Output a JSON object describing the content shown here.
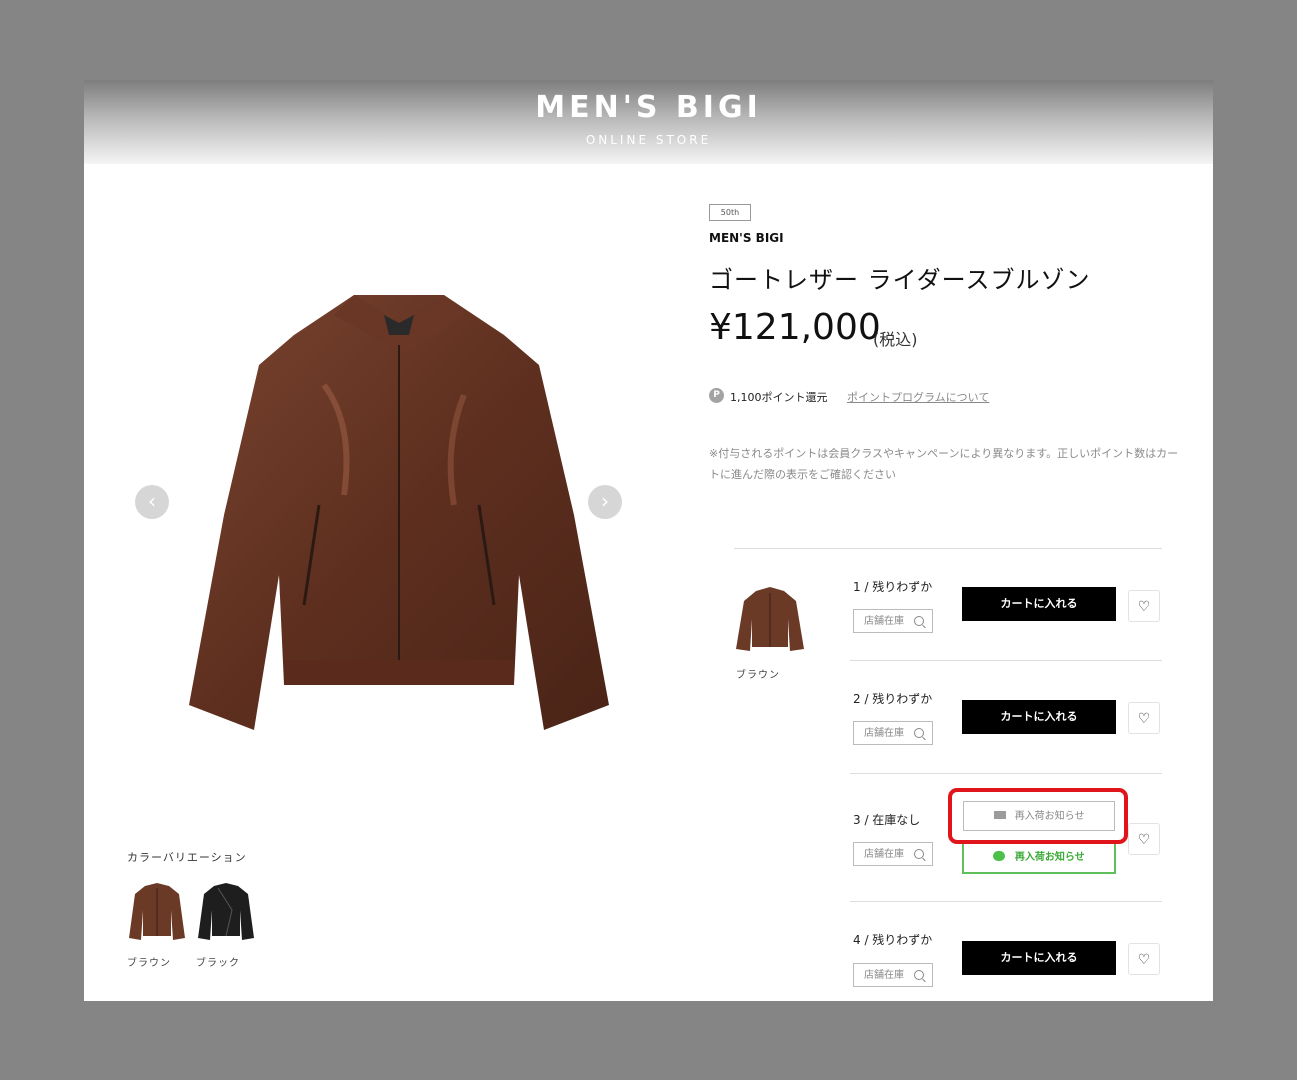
{
  "header": {
    "logo": "MEN'S BIGI",
    "logo_sub": "ONLINE STORE"
  },
  "gallery": {
    "prev_icon": "chevron-left-icon",
    "next_icon": "chevron-right-icon",
    "prev_glyph": "‹",
    "next_glyph": "›"
  },
  "color_variation": {
    "label": "カラーバリエーション",
    "swatches": [
      {
        "name": "ブラウン",
        "color": "#6b3a26"
      },
      {
        "name": "ブラック",
        "color": "#1e1e1e"
      }
    ]
  },
  "product": {
    "badge": "50th",
    "brand": "MEN'S BIGI",
    "title": "ゴートレザー ライダースブルゾン",
    "price": "¥121,000",
    "tax": "(税込)",
    "points_icon": "P",
    "points_text": "1,100ポイント還元",
    "points_link": "ポイントプログラムについて",
    "note": "※付与されるポイントは会員クラスやキャンペーンにより異なります。正しいポイント数はカートに進んだ際の表示をご確認ください"
  },
  "variant": {
    "color_name": "ブラウン",
    "store_stock_label": "店舗在庫",
    "sizes": [
      {
        "label": "1 / 残りわずか",
        "action": "カートに入れる"
      },
      {
        "label": "2 / 残りわずか",
        "action": "カートに入れる"
      },
      {
        "label": "3 / 在庫なし",
        "mail_restock": "再入荷お知らせ",
        "line_restock": "再入荷お知らせ"
      },
      {
        "label": "4 / 残りわずか",
        "action": "カートに入れる"
      }
    ],
    "fav_glyph": "♡"
  },
  "colors": {
    "accent_red": "#e0151b",
    "line_green": "#4cc04a"
  }
}
